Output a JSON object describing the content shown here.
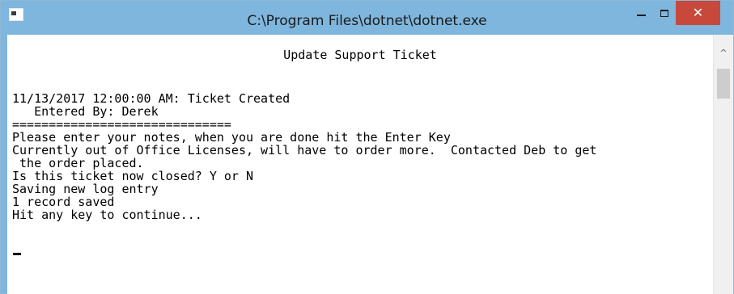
{
  "window": {
    "title": "C:\\Program Files\\dotnet\\dotnet.exe",
    "close_glyph": "✕"
  },
  "console": {
    "header": "Update Support Ticket",
    "lines": [
      "11/13/2017 12:00:00 AM: Ticket Created",
      "   Entered By: Derek",
      "==============================",
      "Please enter your notes, when you are done hit the Enter Key",
      "Currently out of Office Licenses, will have to order more.  Contacted Deb to get",
      " the order placed.",
      "Is this ticket now closed? Y or N",
      "Saving new log entry",
      "1 record saved",
      "Hit any key to continue..."
    ]
  },
  "scrollbar": {
    "up_glyph": "^"
  },
  "colors": {
    "titlebar": "#7fb6dd",
    "close_button": "#c9483c"
  },
  "icons": [
    "console-app-icon",
    "minimize-icon",
    "maximize-icon",
    "close-icon",
    "scroll-up-arrow-icon"
  ]
}
